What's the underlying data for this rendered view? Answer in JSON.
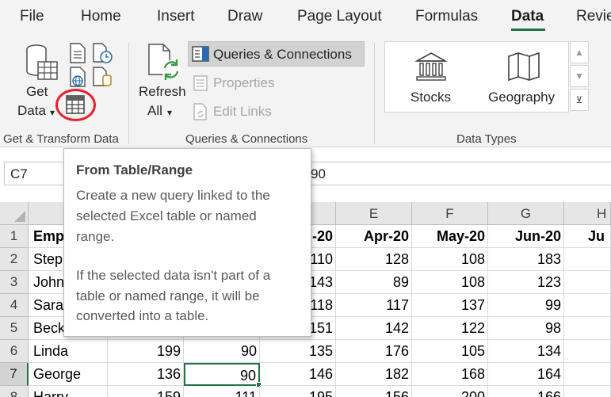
{
  "ribbon_tabs": [
    {
      "label": "File",
      "active": false
    },
    {
      "label": "Home",
      "active": false
    },
    {
      "label": "Insert",
      "active": false
    },
    {
      "label": "Draw",
      "active": false
    },
    {
      "label": "Page Layout",
      "active": false
    },
    {
      "label": "Formulas",
      "active": false
    },
    {
      "label": "Data",
      "active": true
    },
    {
      "label": "Revie",
      "active": false
    }
  ],
  "get_transform": {
    "get_data_line1": "Get",
    "get_data_line2": "Data",
    "group_label": "Get & Transform Data"
  },
  "queries": {
    "refresh_line1": "Refresh",
    "refresh_line2": "All",
    "queries_connections": "Queries & Connections",
    "properties": "Properties",
    "edit_links": "Edit Links",
    "group_label": "Queries & Connections"
  },
  "data_types": {
    "stocks": "Stocks",
    "geography": "Geography",
    "group_label": "Data Types"
  },
  "formula_bar": {
    "name_box": "C7",
    "formula_visible": "90"
  },
  "tooltip": {
    "title": "From Table/Range",
    "paragraph1": [
      "Create a new query linked to the",
      "selected Excel table or named",
      "range."
    ],
    "paragraph2": [
      "If the selected data isn't part of a",
      "table or named range, it will be",
      "converted into a table."
    ]
  },
  "grid": {
    "visible_columns": [
      "E",
      "F",
      "G",
      "H"
    ],
    "visible_rows": [
      "1",
      "2",
      "3",
      "4",
      "5",
      "6",
      "7",
      "8"
    ],
    "selected_cell": "C7",
    "rows": [
      [
        "Emp",
        "",
        "",
        "-20",
        "Apr-20",
        "May-20",
        "Jun-20",
        "Ju"
      ],
      [
        "Step",
        "",
        "",
        "110",
        "128",
        "108",
        "183",
        ""
      ],
      [
        "John",
        "",
        "",
        "143",
        "89",
        "108",
        "123",
        ""
      ],
      [
        "Sara",
        "",
        "",
        "118",
        "117",
        "137",
        "99",
        ""
      ],
      [
        "Beck",
        "",
        "",
        "151",
        "142",
        "122",
        "98",
        ""
      ],
      [
        "Linda",
        "199",
        "90",
        "135",
        "176",
        "105",
        "134",
        ""
      ],
      [
        "George",
        "136",
        "90",
        "146",
        "182",
        "168",
        "164",
        ""
      ],
      [
        "Harry",
        "159",
        "111",
        "195",
        "156",
        "200",
        "166",
        ""
      ]
    ]
  },
  "colors": {
    "accent_green": "#217346",
    "ribbon_bg": "#f3f3f3",
    "annotation_red": "#e8202a"
  }
}
